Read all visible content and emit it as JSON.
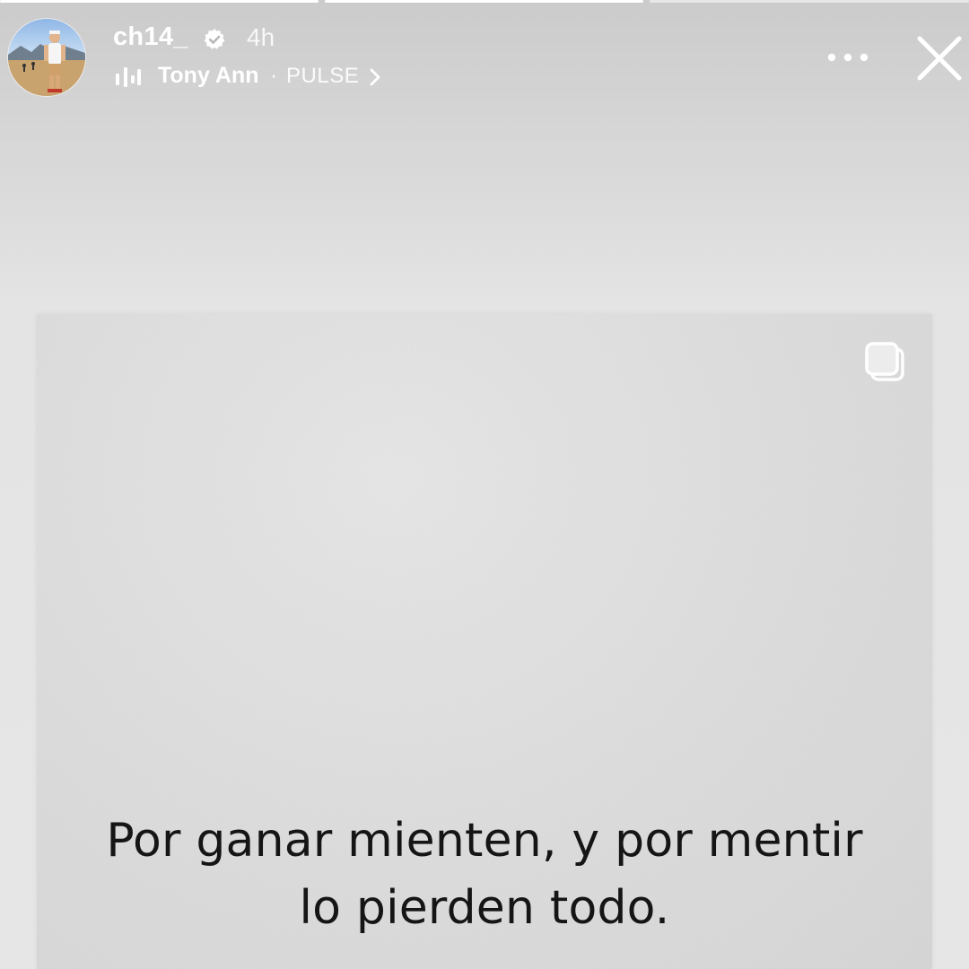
{
  "story": {
    "progress_segments": [
      {
        "state": "viewed",
        "progress": 1.0
      },
      {
        "state": "current",
        "progress": 1.0
      },
      {
        "state": "upcoming",
        "progress": 0.0
      }
    ]
  },
  "header": {
    "username": "ch14_",
    "verified": true,
    "time_ago": "4h",
    "avatar_icon": "profile-photo",
    "more_icon": "more-horizontal-icon",
    "close_icon": "close-icon"
  },
  "music": {
    "icon": "music-bars-icon",
    "artist": "Tony Ann",
    "separator": "·",
    "song": "PULSE",
    "chevron_icon": "chevron-right-icon"
  },
  "post": {
    "carousel_icon": "carousel-icon",
    "quote_line_1": "Por ganar mienten, y por mentir",
    "quote_line_2": "lo pierden todo."
  },
  "colors": {
    "text_light": "#ffffff",
    "quote_text": "#151515",
    "background": "#e4e4e4",
    "card": "#e0e0e0"
  }
}
